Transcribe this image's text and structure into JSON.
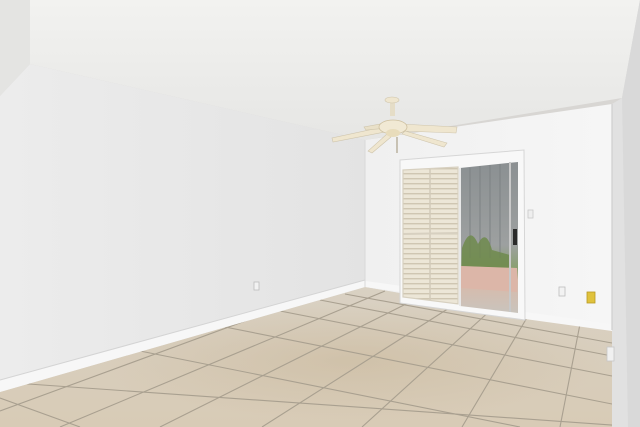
{
  "photo": {
    "subject": "empty-room-interior",
    "objects": [
      "ceiling-fan",
      "sliding-glass-door",
      "louvered-shutter-panel",
      "tile-floor",
      "baseboard",
      "wall-outlet",
      "light-switch"
    ]
  },
  "colors": {
    "ceiling": "#eeeeec",
    "left_wall": "#e9e9e9",
    "back_wall": "#f4f4f4",
    "right_wall": "#e2e2e2",
    "floor_tile": "#d7cdbd",
    "grout": "#a59c8c",
    "shutter": "#e9e2d2",
    "door_glass": "#8f9495",
    "fan": "#efe6cf",
    "outlet_yellow": "#e0c23c"
  }
}
